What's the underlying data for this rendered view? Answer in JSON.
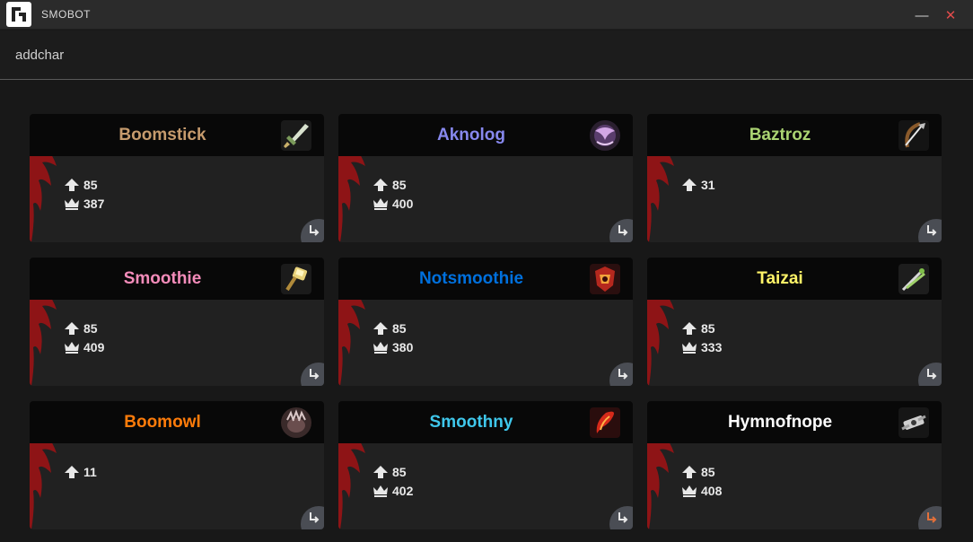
{
  "window": {
    "title": "SMOBOT",
    "minimize_glyph": "—",
    "close_glyph": "✕"
  },
  "page": {
    "heading": "addchar"
  },
  "characters": [
    {
      "name": "Boomstick",
      "color": "#c69b6d",
      "icon": "sword-icon",
      "level": "85",
      "item_level": "387"
    },
    {
      "name": "Aknolog",
      "color": "#8788ee",
      "icon": "shadow-icon",
      "level": "85",
      "item_level": "400"
    },
    {
      "name": "Baztroz",
      "color": "#aad372",
      "icon": "bow-icon",
      "level": "31"
    },
    {
      "name": "Smoothie",
      "color": "#f48cba",
      "icon": "hammer-icon",
      "level": "85",
      "item_level": "409"
    },
    {
      "name": "Notsmoothie",
      "color": "#0070dd",
      "icon": "totem-icon",
      "level": "85",
      "item_level": "380"
    },
    {
      "name": "Taizai",
      "color": "#fff468",
      "icon": "daggers-icon",
      "level": "85",
      "item_level": "333"
    },
    {
      "name": "Boomowl",
      "color": "#ff7c0a",
      "icon": "paw-icon",
      "level": "11"
    },
    {
      "name": "Smoothny",
      "color": "#3fc7eb",
      "icon": "fire-icon",
      "level": "85",
      "item_level": "402"
    },
    {
      "name": "Hymnofnope",
      "color": "#ffffff",
      "icon": "holy-icon",
      "level": "85",
      "item_level": "408"
    }
  ],
  "colors": {
    "emblem": "#8e1416",
    "login_button": "#4a4d54",
    "login_button_active": "#e2703a"
  },
  "active_login_index": 8
}
